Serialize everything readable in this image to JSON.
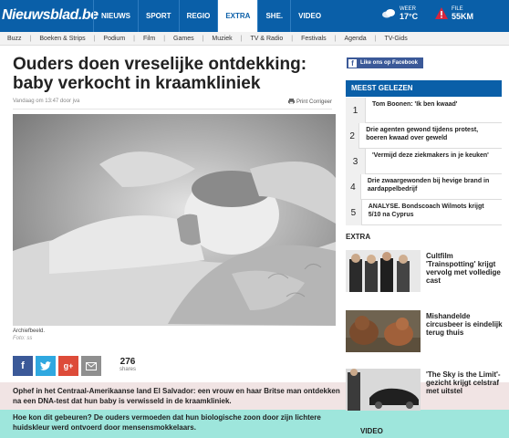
{
  "header": {
    "logo": "Nieuwsblad.be",
    "tabs": [
      "NIEUWS",
      "SPORT",
      "REGIO",
      "EXTRA",
      "SHE.",
      "VIDEO"
    ],
    "active_tab": "EXTRA",
    "weather_label": "WEER",
    "weather_value": "17°C",
    "traffic_label": "FILE",
    "traffic_value": "55KM"
  },
  "subnav": [
    "Buzz",
    "Boeken & Strips",
    "Podium",
    "Film",
    "Games",
    "Muziek",
    "TV & Radio",
    "Festivals",
    "Agenda",
    "TV-Gids"
  ],
  "article": {
    "headline": "Ouders doen vreselijke ontdekking: baby verkocht in kraamkliniek",
    "meta": "Vandaag om 13:47 door jva",
    "print_label": "Print",
    "correct_label": "Corrigeer",
    "caption": "Archiefbeeld.",
    "credit": "Foto: ss",
    "share_count": "276",
    "share_label": "shares",
    "intro_1": "Ophef in het Centraal-Amerikaanse land El Salvador: een vrouw en haar Britse man ontdekken na een DNA-test dat hun baby is verwisseld in de kraamkliniek.",
    "intro_2": "Hoe kon dit gebeuren? De ouders vermoeden dat hun biologische zoon door zijn lichtere huidskleur werd ontvoerd door mensensmokkelaars."
  },
  "sidebar": {
    "fb_like": "Like ons op Facebook",
    "most_read_title": "MEEST GELEZEN",
    "most_read": [
      {
        "num": "1",
        "title": "Tom Boonen: 'Ik ben kwaad'"
      },
      {
        "num": "2",
        "title": "Drie agenten gewond tijdens protest, boeren kwaad over geweld"
      },
      {
        "num": "3",
        "title": "'Vermijd deze ziekmakers in je keuken'"
      },
      {
        "num": "4",
        "title": "Drie zwaargewonden bij hevige brand in aardappelbedrijf"
      },
      {
        "num": "5",
        "title": "ANALYSE. Bondscoach Wilmots krijgt 5/10 na Cyprus"
      }
    ],
    "extra_title": "EXTRA",
    "extra": [
      {
        "title": "Cultfilm 'Trainspotting' krijgt vervolg met volledige cast"
      },
      {
        "title": "Mishandelde circusbeer is eindelijk terug thuis"
      },
      {
        "title": "'The Sky is the Limit'-gezicht krijgt celstraf met uitstel"
      }
    ],
    "video_title": "VIDEO"
  }
}
